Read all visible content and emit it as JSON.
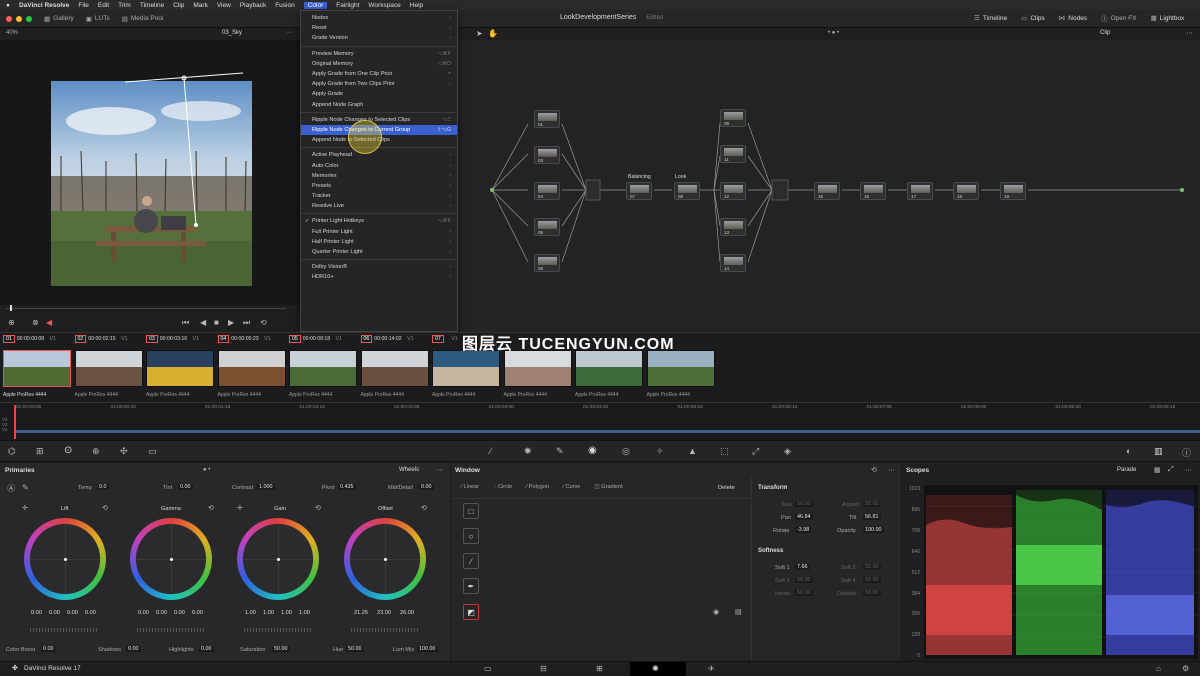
{
  "menubar": {
    "app": "DaVinci Resolve",
    "items": [
      "File",
      "Edit",
      "Trim",
      "Timeline",
      "Clip",
      "Mark",
      "View",
      "Playback",
      "Fusion",
      "Color",
      "Fairlight",
      "Workspace",
      "Help"
    ]
  },
  "topbar": {
    "gallery": "Gallery",
    "luts": "LUTs",
    "media_pool": "Media Pool",
    "project": "LookDevelopmentSeries",
    "edited": "Edited",
    "timeline": "Timeline",
    "clips": "Clips",
    "nodes": "Nodes",
    "open_fx": "Open FX",
    "lightbox": "Lightbox"
  },
  "viewer": {
    "zoom": "40%",
    "clip_name": "03_Sky"
  },
  "node_editor": {
    "mode": "Clip",
    "tag_balancing": "Balancing",
    "tag_look": "Look"
  },
  "color_menu": [
    {
      "label": "Nodes",
      "sc": "",
      "arrow": true
    },
    {
      "label": "Reset",
      "sc": "",
      "arrow": true
    },
    {
      "label": "Grade Version",
      "sc": "",
      "arrow": true
    },
    {
      "sep": true
    },
    {
      "label": "Preview Memory",
      "sc": "⌥⌘P"
    },
    {
      "label": "Original Memory",
      "sc": "⌥⌘O"
    },
    {
      "label": "Apply Grade from One Clip Prior",
      "sc": "="
    },
    {
      "label": "Apply Grade from Two Clips Prior",
      "sc": "−"
    },
    {
      "label": "Apply Grade",
      "sc": ""
    },
    {
      "label": "Append Node Graph",
      "sc": ""
    },
    {
      "sep": true
    },
    {
      "label": "Ripple Node Changes to Selected Clips",
      "sc": "⌥C"
    },
    {
      "label": "Ripple Node Changes to Current Group",
      "sc": "⇧⌥G",
      "hl": true
    },
    {
      "label": "Append Node to Selected Clips",
      "sc": ""
    },
    {
      "sep": true
    },
    {
      "label": "Active Playhead",
      "sc": "",
      "arrow": true
    },
    {
      "label": "Auto Color",
      "sc": "",
      "arrow": true
    },
    {
      "label": "Memories",
      "sc": "",
      "arrow": true
    },
    {
      "label": "Presets",
      "sc": "",
      "arrow": true
    },
    {
      "label": "Tracker",
      "sc": "",
      "arrow": true
    },
    {
      "label": "Resolve Live",
      "sc": "",
      "arrow": true
    },
    {
      "sep": true
    },
    {
      "label": "Printer Light Hotkeys",
      "sc": "⌥⌘K",
      "check": true
    },
    {
      "label": "Full Printer Light",
      "sc": "",
      "arrow": true
    },
    {
      "label": "Half Printer Light",
      "sc": "",
      "arrow": true
    },
    {
      "label": "Quarter Printer Light",
      "sc": "",
      "arrow": true
    },
    {
      "sep": true
    },
    {
      "label": "Dolby Vision®",
      "sc": "",
      "arrow": true
    },
    {
      "label": "HDR10+",
      "sc": "",
      "arrow": true
    }
  ],
  "clips": [
    {
      "num": "01",
      "tc": "00:00:00:08",
      "track": "V1",
      "codec": "Apple ProRes 4444"
    },
    {
      "num": "02",
      "tc": "00:00:02:15",
      "track": "V1",
      "codec": "Apple ProRes 4444"
    },
    {
      "num": "03",
      "tc": "00:00:03:16",
      "track": "V1",
      "codec": "Apple ProRes 4444"
    },
    {
      "num": "04",
      "tc": "00:00:05:23",
      "track": "V1",
      "codec": "Apple ProRes 4444"
    },
    {
      "num": "05",
      "tc": "00:00:08:18",
      "track": "V1",
      "codec": "Apple ProRes 4444"
    },
    {
      "num": "06",
      "tc": "00:00:14:02",
      "track": "V1",
      "codec": "Apple ProRes 4444"
    },
    {
      "num": "07",
      "tc": "",
      "track": "V1",
      "codec": "Apple ProRes 4444"
    },
    {
      "num": "",
      "tc": "",
      "track": "",
      "codec": "Apple ProRes 4444"
    },
    {
      "num": "",
      "tc": "",
      "track": "",
      "codec": "Apple ProRes 4444"
    },
    {
      "num": "",
      "tc": "",
      "track": "",
      "codec": "Apple ProRes 4444"
    }
  ],
  "ruler": [
    "01:00:00:00",
    "01:00:00:20",
    "01:00:01:15",
    "01:00:02:10",
    "01:00:03:05",
    "01:00:04:00",
    "01:00:04:20",
    "01:00:05:15",
    "01:00:06:10",
    "01:00:07:05",
    "01:00:08:00",
    "01:00:08:20",
    "01:00:09:15"
  ],
  "tracks": [
    "V3",
    "V2",
    "V1"
  ],
  "watermark": "图层云 TUCENGYUN.COM",
  "primaries": {
    "title": "Primaries",
    "mode": "Wheels",
    "temp_label": "Temp",
    "temp": "0.0",
    "tint_label": "Tint",
    "tint": "0.00",
    "contrast_label": "Contrast",
    "contrast": "1.000",
    "pivot_label": "Pivot",
    "pivot": "0.435",
    "middetail_label": "Mid/Detail",
    "middetail": "0.00",
    "wheels": [
      {
        "name": "Lift",
        "vals": [
          "0.00",
          "0.00",
          "0.00",
          "0.00"
        ]
      },
      {
        "name": "Gamma",
        "vals": [
          "0.00",
          "0.00",
          "0.00",
          "0.00"
        ]
      },
      {
        "name": "Gain",
        "vals": [
          "1.00",
          "1.00",
          "1.00",
          "1.00"
        ]
      },
      {
        "name": "Offset",
        "vals": [
          "21.25",
          "23.00",
          "26.00"
        ]
      }
    ],
    "colorboost_label": "Color Boost",
    "colorboost": "0.00",
    "shadows_label": "Shadows",
    "shadows": "0.00",
    "highlights_label": "Highlights",
    "highlights": "0.00",
    "saturation_label": "Saturation",
    "saturation": "50.00",
    "hue_label": "Hue",
    "hue": "50.00",
    "lummix_label": "Lum Mix",
    "lummix": "100.00"
  },
  "window_panel": {
    "title": "Window",
    "tools": [
      "Linear",
      "Circle",
      "Polygon",
      "Curve",
      "Gradient"
    ],
    "delete": "Delete",
    "transform": "Transform",
    "size_label": "Size",
    "size": "50.00",
    "aspect_label": "Aspect",
    "aspect": "50.00",
    "pan_label": "Pan",
    "pan": "46.84",
    "tilt_label": "Tilt",
    "tilt": "56.81",
    "rotate_label": "Rotate",
    "rotate": "-3.98",
    "opacity_label": "Opacity",
    "opacity": "100.00",
    "softness": "Softness",
    "soft1_label": "Soft 1",
    "soft1": "7.66",
    "soft2_label": "Soft 2",
    "soft2": "50.00",
    "soft3_label": "Soft 3",
    "soft3": "50.00",
    "soft4_label": "Soft 4",
    "soft4": "50.00",
    "inside_label": "Inside",
    "inside": "50.00",
    "outside_label": "Outside",
    "outside": "50.00"
  },
  "scopes": {
    "title": "Scopes",
    "mode": "Parade",
    "scale": [
      "1023",
      "896",
      "768",
      "640",
      "512",
      "384",
      "256",
      "128",
      "0"
    ]
  },
  "footer": {
    "app": "DaVinci Resolve 17"
  },
  "colors": {
    "accent": "#3a5fcf",
    "red_dot": "#ff5f57",
    "yellow_dot": "#febc2e",
    "green_dot": "#28c840"
  }
}
